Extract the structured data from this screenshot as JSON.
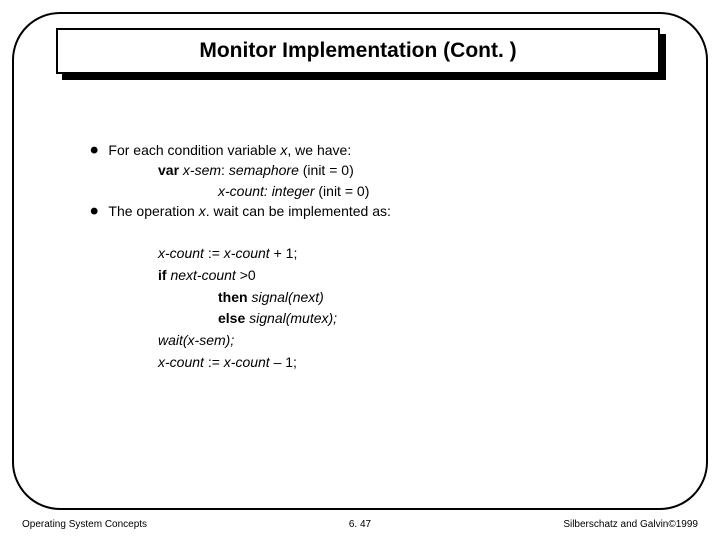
{
  "title": "Monitor Implementation (Cont. )",
  "bullets": {
    "b1": {
      "lead": "For each condition variable ",
      "var_x": "x",
      "tail": ", we  have:"
    },
    "b1_sub1": {
      "kw_var": "var ",
      "name1": "x-sem",
      "colon1": ": ",
      "type1": "semaphore ",
      "init1": "(init = 0)"
    },
    "b1_sub2": {
      "name2": "x-count: integer ",
      "init2": "(init = 0)"
    },
    "b2": {
      "lead": "The operation ",
      "op": "x",
      "tail": ". wait can be implemented as:"
    }
  },
  "code": {
    "l1_a": "x-count ",
    "l1_b": ":= ",
    "l1_c": "x-count ",
    "l1_d": "+ 1;",
    "l2_a": "if ",
    "l2_b": "next-count ",
    "l2_c": ">0",
    "l3_a": "then ",
    "l3_b": "signal(next)",
    "l4_a": "else ",
    "l4_b": "signal(mutex);",
    "l5": "wait(x-sem);",
    "l6_a": "x-count ",
    "l6_b": ":= ",
    "l6_c": "x-count ",
    "l6_d": "– 1;"
  },
  "footer": {
    "left": "Operating System Concepts",
    "center": "6. 47",
    "right_a": "Silberschatz and Galvin",
    "right_b": "1999",
    "copy": "©"
  }
}
